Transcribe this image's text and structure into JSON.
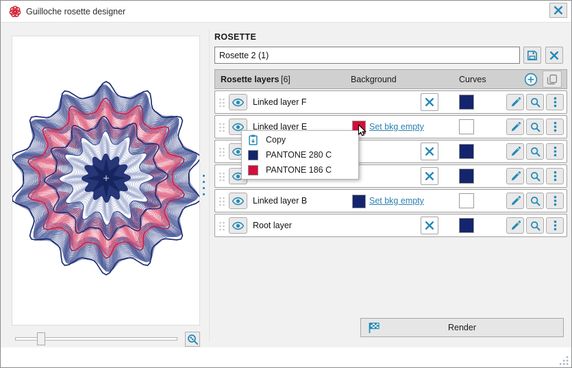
{
  "window": {
    "title": "Guilloche rosette designer"
  },
  "rosette_section": {
    "heading": "ROSETTE",
    "name_value": "Rosette 2 (1)"
  },
  "layers_table": {
    "title": "Rosette layers",
    "count": "[6]",
    "col_background": "Background",
    "col_curves": "Curves",
    "rows": [
      {
        "name": "Linked layer F",
        "bg_type": "empty",
        "curves_color": "#15256d"
      },
      {
        "name": "Linked layer E",
        "bg_type": "color",
        "bg_color": "#d20f3a",
        "bg_action": "Set bkg empty",
        "curves_color": "#ffffff"
      },
      {
        "name": "",
        "bg_type": "empty",
        "curves_color": "#15256d"
      },
      {
        "name": "",
        "bg_type": "empty",
        "curves_color": "#15256d"
      },
      {
        "name": "Linked layer B",
        "bg_type": "color",
        "bg_color": "#15256d",
        "bg_action": "Set bkg empty",
        "curves_color": "#ffffff"
      },
      {
        "name": "Root layer",
        "bg_type": "empty",
        "curves_color": "#15256d"
      }
    ]
  },
  "context_menu": {
    "items": [
      {
        "label": "Copy",
        "kind": "copy"
      },
      {
        "label": "PANTONE 280 C",
        "kind": "swatch",
        "color": "#15256d"
      },
      {
        "label": "PANTONE 186 C",
        "kind": "swatch",
        "color": "#d20f3a"
      }
    ]
  },
  "preview": {
    "zoom_slider_percent": 14
  },
  "actions": {
    "render_label": "Render"
  },
  "colors": {
    "accent": "#2589b5",
    "navy": "#15256d",
    "red": "#d20f3a"
  }
}
